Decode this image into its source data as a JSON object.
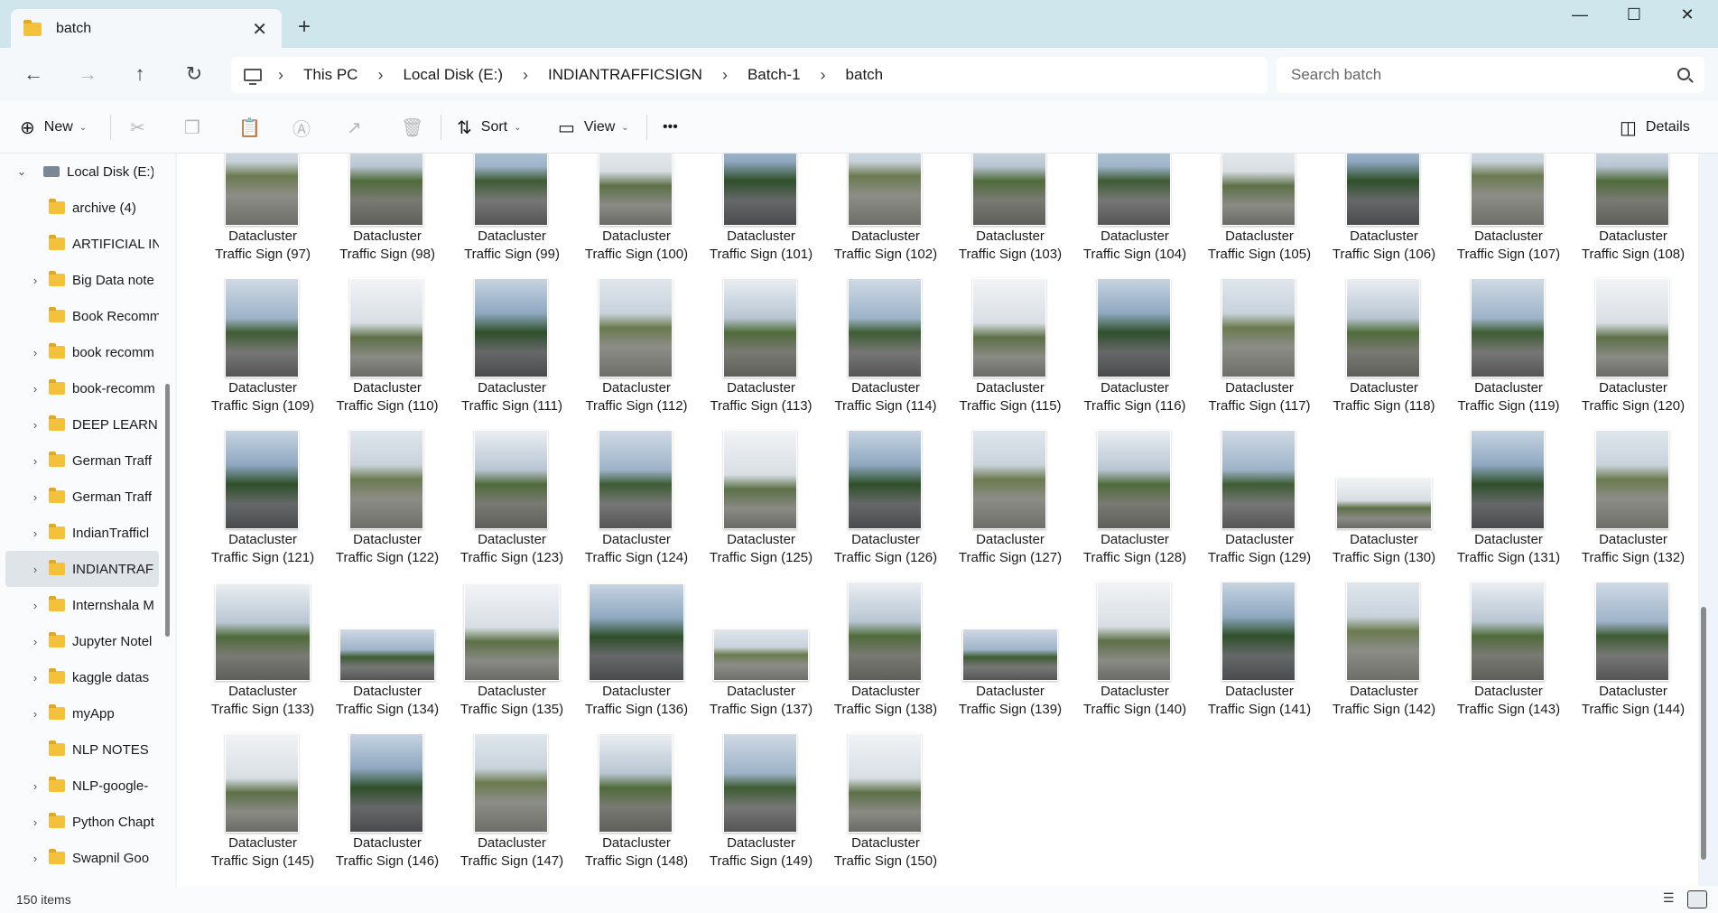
{
  "window": {
    "tab_title": "batch",
    "tab_close": "✕",
    "new_tab": "+",
    "minimize": "—",
    "maximize": "☐",
    "close": "✕"
  },
  "nav": {
    "back": "←",
    "forward": "→",
    "up": "↑",
    "refresh": "↻"
  },
  "address": {
    "crumbs": [
      "This PC",
      "Local Disk (E:)",
      "INDIANTRAFFICSIGN",
      "Batch-1",
      "batch"
    ],
    "separator": "›"
  },
  "search": {
    "placeholder": "Search batch"
  },
  "toolbar": {
    "new_label": "New",
    "sort_label": "Sort",
    "view_label": "View",
    "more_label": "•••",
    "details_label": "Details"
  },
  "sidebar": {
    "items": [
      {
        "label": "Local Disk (E:)",
        "chevron": "⌄",
        "type": "drive"
      },
      {
        "label": "archive (4)",
        "chevron": "",
        "type": "folder"
      },
      {
        "label": "ARTIFICIAL IN",
        "chevron": "",
        "type": "folder"
      },
      {
        "label": "Big Data note",
        "chevron": "›",
        "type": "folder"
      },
      {
        "label": "Book Recomm",
        "chevron": "",
        "type": "folder"
      },
      {
        "label": "book recomm",
        "chevron": "›",
        "type": "folder"
      },
      {
        "label": "book-recomm",
        "chevron": "›",
        "type": "folder"
      },
      {
        "label": "DEEP LEARNI",
        "chevron": "›",
        "type": "folder"
      },
      {
        "label": "German Traff",
        "chevron": "›",
        "type": "folder"
      },
      {
        "label": "German Traff",
        "chevron": "›",
        "type": "folder"
      },
      {
        "label": "IndianTrafficl",
        "chevron": "›",
        "type": "folder"
      },
      {
        "label": "INDIANTRAF",
        "chevron": "›",
        "type": "folder",
        "selected": true
      },
      {
        "label": "Internshala M",
        "chevron": "›",
        "type": "folder"
      },
      {
        "label": "Jupyter Notel",
        "chevron": "›",
        "type": "folder"
      },
      {
        "label": "kaggle datas",
        "chevron": "›",
        "type": "folder"
      },
      {
        "label": "myApp",
        "chevron": "›",
        "type": "folder"
      },
      {
        "label": "NLP NOTES",
        "chevron": "",
        "type": "folder"
      },
      {
        "label": "NLP-google-",
        "chevron": "›",
        "type": "folder"
      },
      {
        "label": "Python Chapt",
        "chevron": "›",
        "type": "folder"
      },
      {
        "label": "Swapnil Goo",
        "chevron": "›",
        "type": "folder"
      }
    ]
  },
  "files": {
    "line1": "Datacluster",
    "items": [
      "Traffic Sign (97)",
      "Traffic Sign (98)",
      "Traffic Sign (99)",
      "Traffic Sign (100)",
      "Traffic Sign (101)",
      "Traffic Sign (102)",
      "Traffic Sign (103)",
      "Traffic Sign (104)",
      "Traffic Sign (105)",
      "Traffic Sign (106)",
      "Traffic Sign (107)",
      "Traffic Sign (108)",
      "Traffic Sign (109)",
      "Traffic Sign (110)",
      "Traffic Sign (111)",
      "Traffic Sign (112)",
      "Traffic Sign (113)",
      "Traffic Sign (114)",
      "Traffic Sign (115)",
      "Traffic Sign (116)",
      "Traffic Sign (117)",
      "Traffic Sign (118)",
      "Traffic Sign (119)",
      "Traffic Sign (120)",
      "Traffic Sign (121)",
      "Traffic Sign (122)",
      "Traffic Sign (123)",
      "Traffic Sign (124)",
      "Traffic Sign (125)",
      "Traffic Sign (126)",
      "Traffic Sign (127)",
      "Traffic Sign (128)",
      "Traffic Sign (129)",
      "Traffic Sign (130)",
      "Traffic Sign (131)",
      "Traffic Sign (132)",
      "Traffic Sign (133)",
      "Traffic Sign (134)",
      "Traffic Sign (135)",
      "Traffic Sign (136)",
      "Traffic Sign (137)",
      "Traffic Sign (138)",
      "Traffic Sign (139)",
      "Traffic Sign (140)",
      "Traffic Sign (141)",
      "Traffic Sign (142)",
      "Traffic Sign (143)",
      "Traffic Sign (144)",
      "Traffic Sign (145)",
      "Traffic Sign (146)",
      "Traffic Sign (147)",
      "Traffic Sign (148)",
      "Traffic Sign (149)",
      "Traffic Sign (150)"
    ]
  },
  "status": {
    "count": "150 items"
  }
}
